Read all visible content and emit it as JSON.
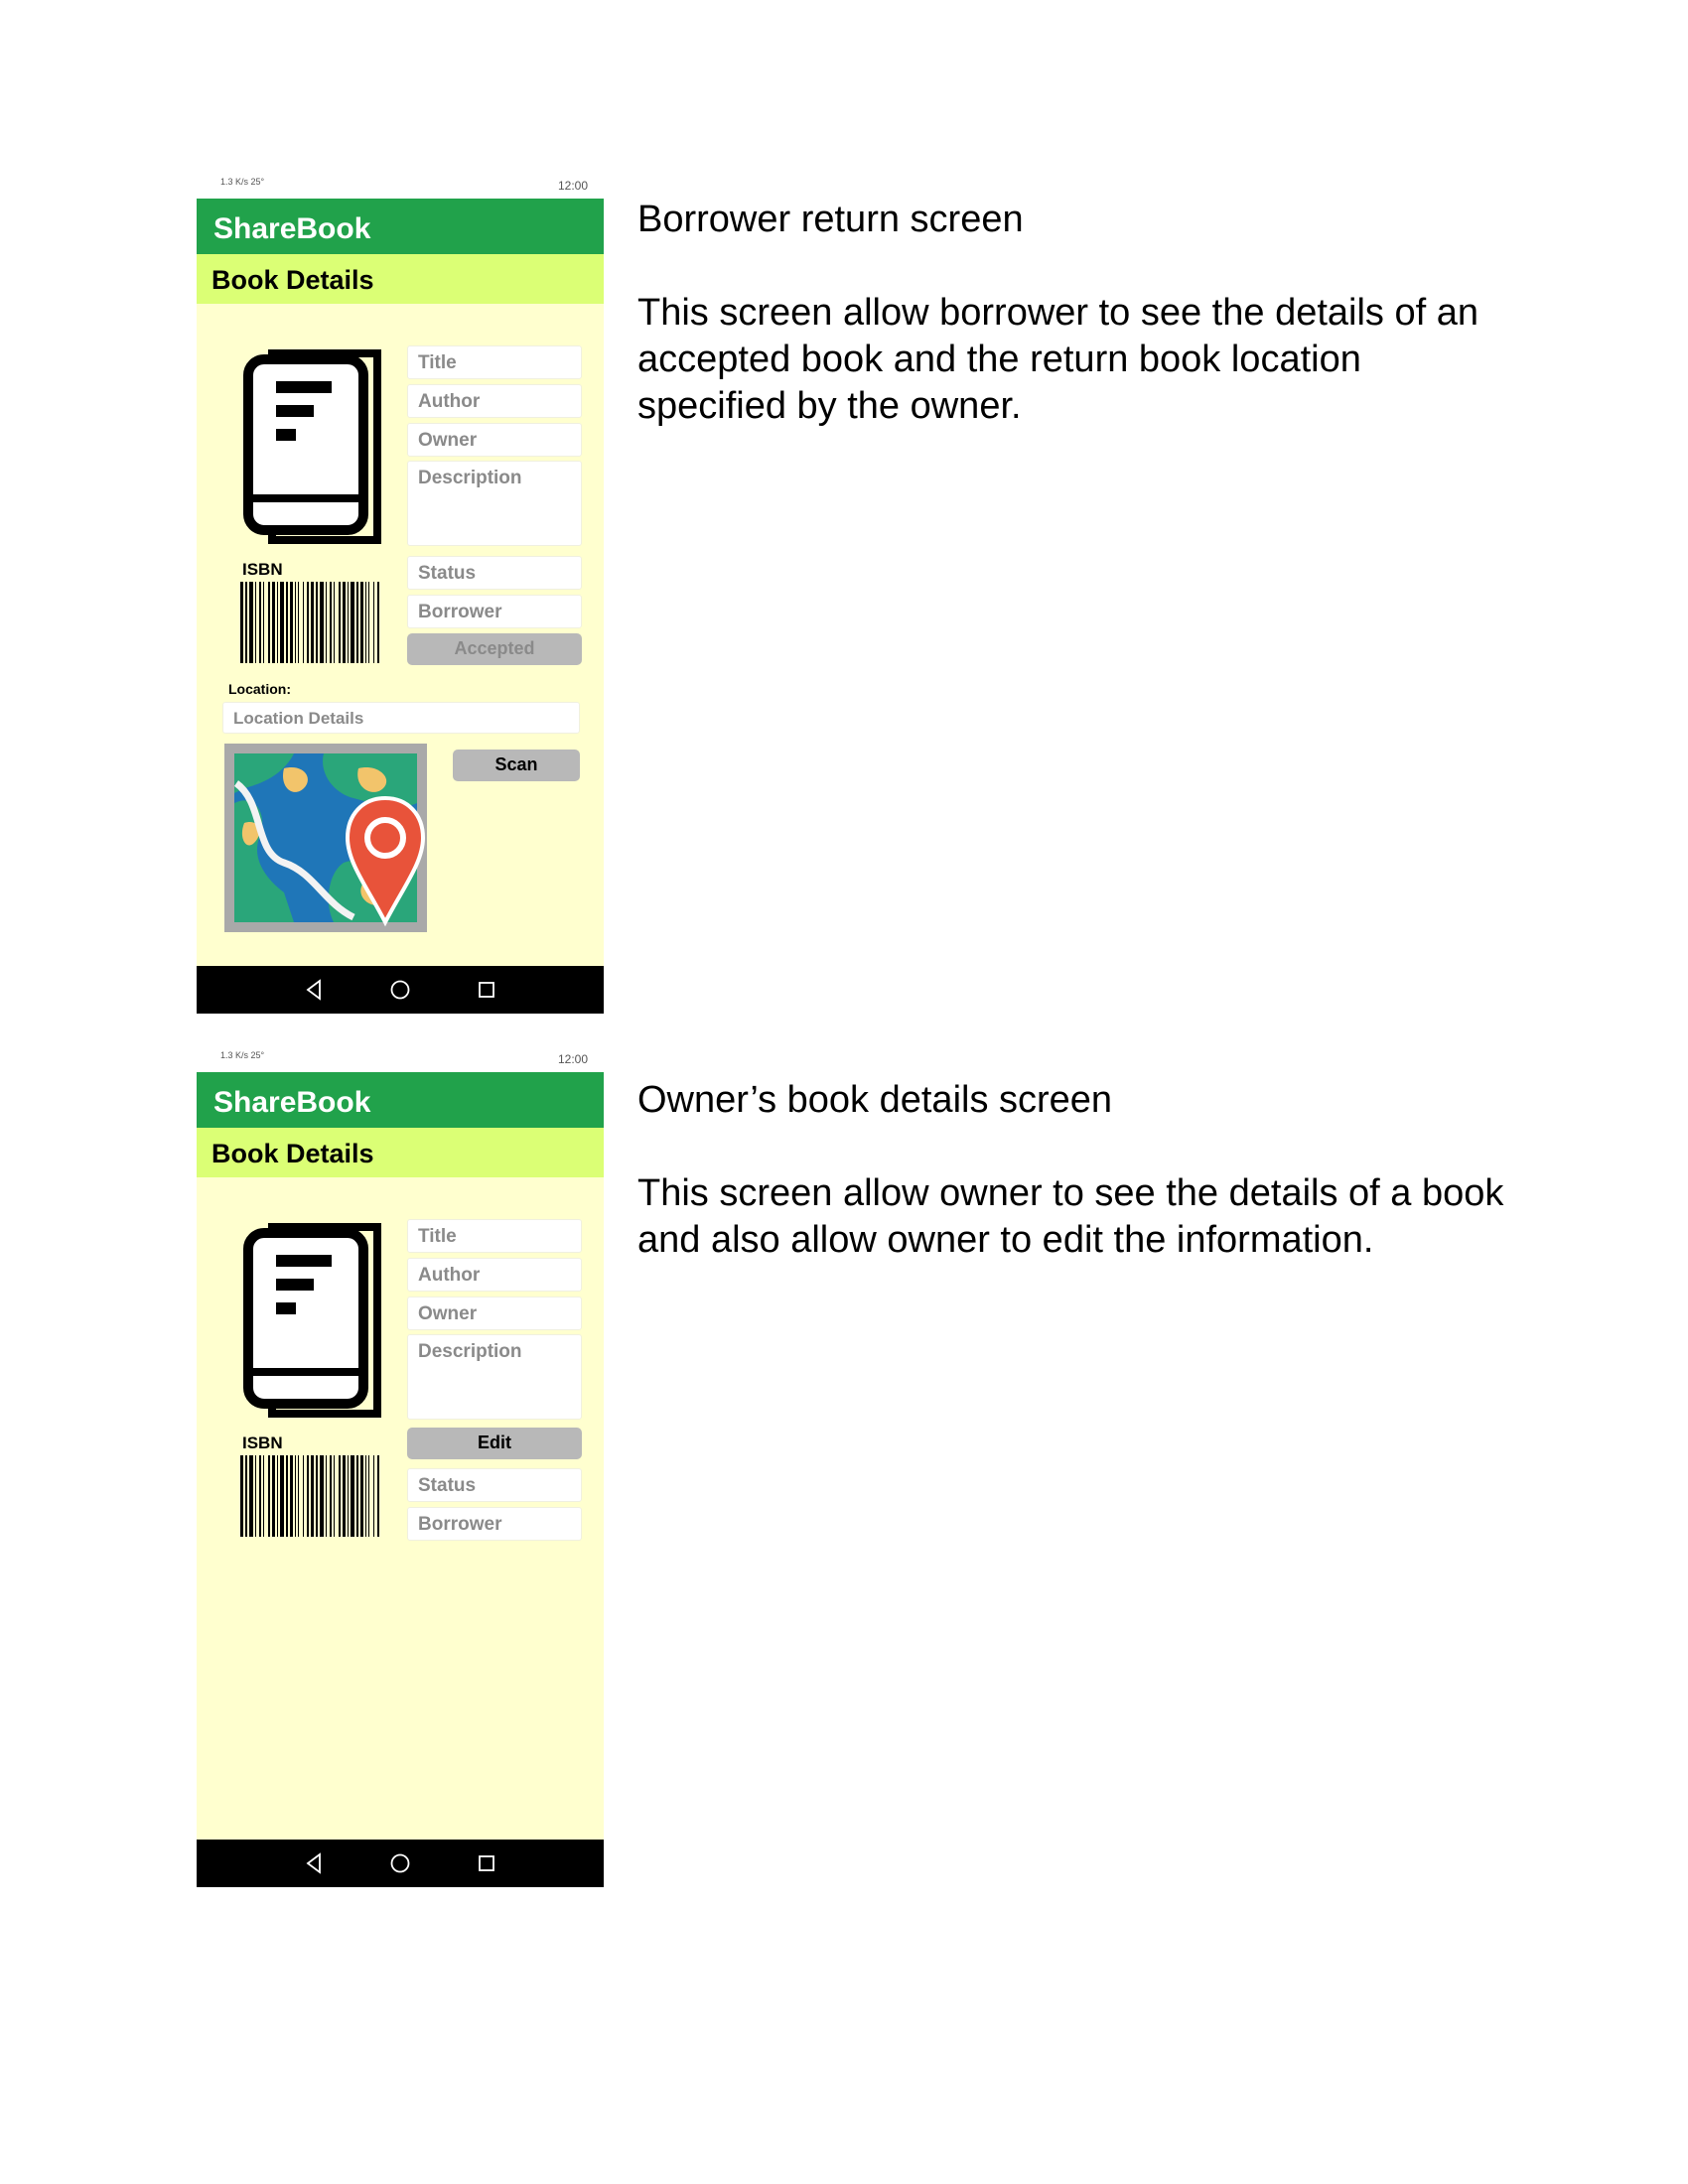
{
  "screen1": {
    "status": {
      "left": "1.3 K/s 25°",
      "time": "12:00"
    },
    "app_title": "ShareBook",
    "section_title": "Book Details",
    "fields": {
      "title": "Title",
      "author": "Author",
      "owner": "Owner",
      "description": "Description",
      "status": "Status",
      "borrower": "Borrower"
    },
    "isbn_label": "ISBN",
    "accepted_label": "Accepted",
    "location_label": "Location:",
    "location_placeholder": "Location Details",
    "scan_label": "Scan",
    "caption_heading": "Borrower return screen",
    "caption_body": "This screen allow borrower to see the details of an accepted book and the return book location specified by the owner."
  },
  "screen2": {
    "status": {
      "left": "1.3 K/s 25°",
      "time": "12:00"
    },
    "app_title": "ShareBook",
    "section_title": "Book Details",
    "fields": {
      "title": "Title",
      "author": "Author",
      "owner": "Owner",
      "description": "Description",
      "status": "Status",
      "borrower": "Borrower"
    },
    "isbn_label": "ISBN",
    "edit_label": "Edit",
    "caption_heading": "Owner’s book details screen",
    "caption_body": "This screen allow owner to see the details of a book and also allow owner to edit the information."
  },
  "colors": {
    "app_bar": "#21a24b",
    "sub_bar": "#dbff75",
    "content_bg": "#ffffcf",
    "nav_bar": "#000000",
    "button_gray": "#b8b8b8"
  },
  "icons": [
    "book-icon",
    "barcode-icon",
    "map-pin-icon",
    "back-icon",
    "home-icon",
    "recents-icon"
  ]
}
